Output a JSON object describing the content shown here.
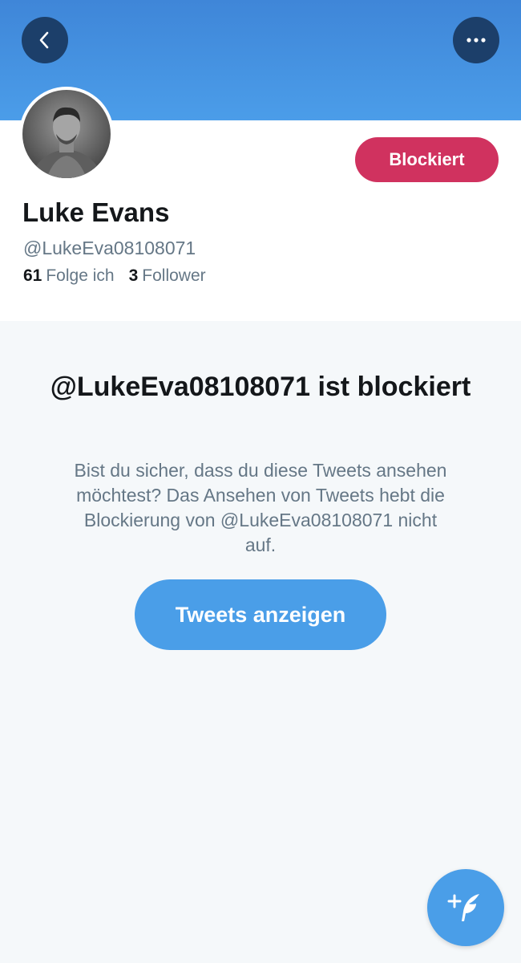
{
  "header": {
    "back_icon": "chevron-left-icon",
    "more_icon": "more-horizontal-icon"
  },
  "profile": {
    "display_name": "Luke Evans",
    "handle": "@LukeEva08108071",
    "blocked_button_label": "Blockiert",
    "following_count": "61",
    "following_label": "Folge ich",
    "followers_count": "3",
    "followers_label": "Follower"
  },
  "blocked_notice": {
    "title": "@LukeEva08108071 ist blockiert",
    "description": "Bist du sicher, dass du diese Tweets ansehen möchtest? Das Ansehen von Tweets hebt die Blockierung von @LukeEva08108071 nicht auf.",
    "show_tweets_label": "Tweets anzeigen"
  },
  "compose": {
    "icon": "compose-tweet-icon"
  },
  "colors": {
    "banner": "#4b9de9",
    "blocked_button": "#d0325f",
    "primary_button": "#4a9ee8",
    "text_primary": "#14171a",
    "text_secondary": "#657786"
  }
}
